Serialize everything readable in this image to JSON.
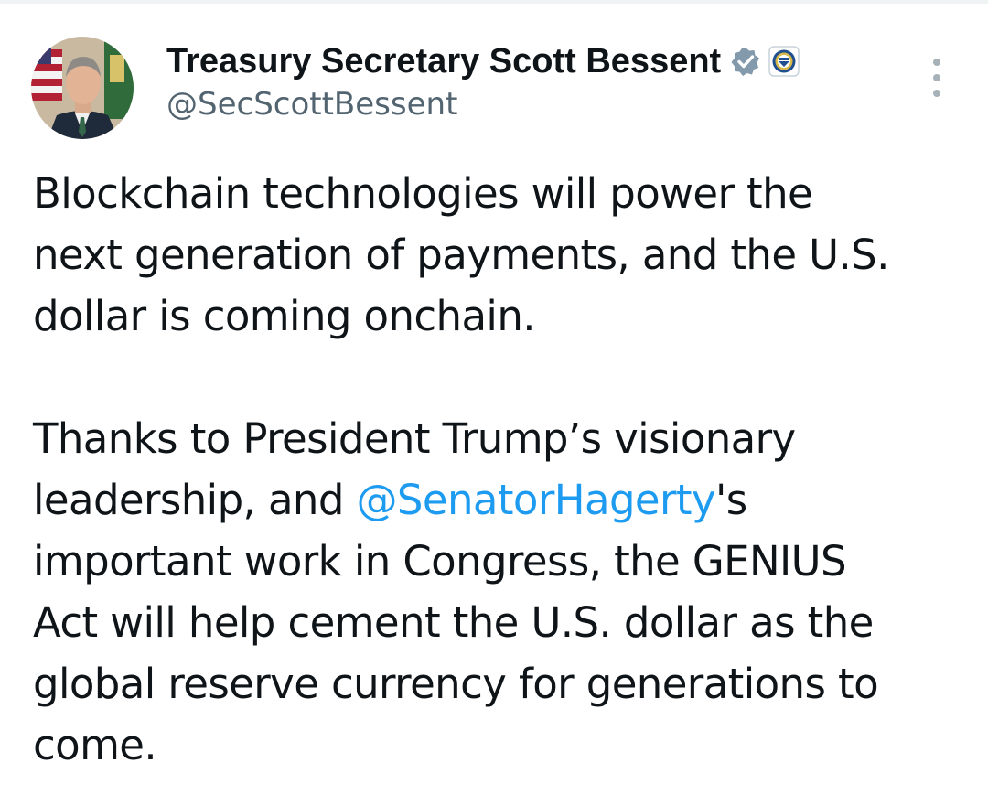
{
  "tweet": {
    "author": {
      "display_name": "Treasury Secretary Scott Bessent",
      "handle": "@SecScottBessent",
      "verified_icon": "gray-verified-badge-icon",
      "affiliation_icon": "treasury-seal-icon"
    },
    "menu_icon": "more-vertical-icon",
    "paragraph_1": {
      "line_1": "Blockchain technologies will power the",
      "line_2": "next generation of payments, and the U.S.",
      "line_3": "dollar is coming onchain."
    },
    "paragraph_2": {
      "line_1": "Thanks to President Trump’s visionary",
      "line_2_before": "leadership, and ",
      "line_2_mention": "@SenatorHagerty",
      "line_2_after": "'s",
      "line_3": "important work in Congress, the GENIUS",
      "line_4": "Act will help cement the U.S. dollar as the",
      "line_5": "global reserve currency for generations to",
      "line_6": "come."
    }
  },
  "colors": {
    "text": "#0f1419",
    "secondary": "#536471",
    "link": "#1d9bf0",
    "badge": "#829aab"
  }
}
